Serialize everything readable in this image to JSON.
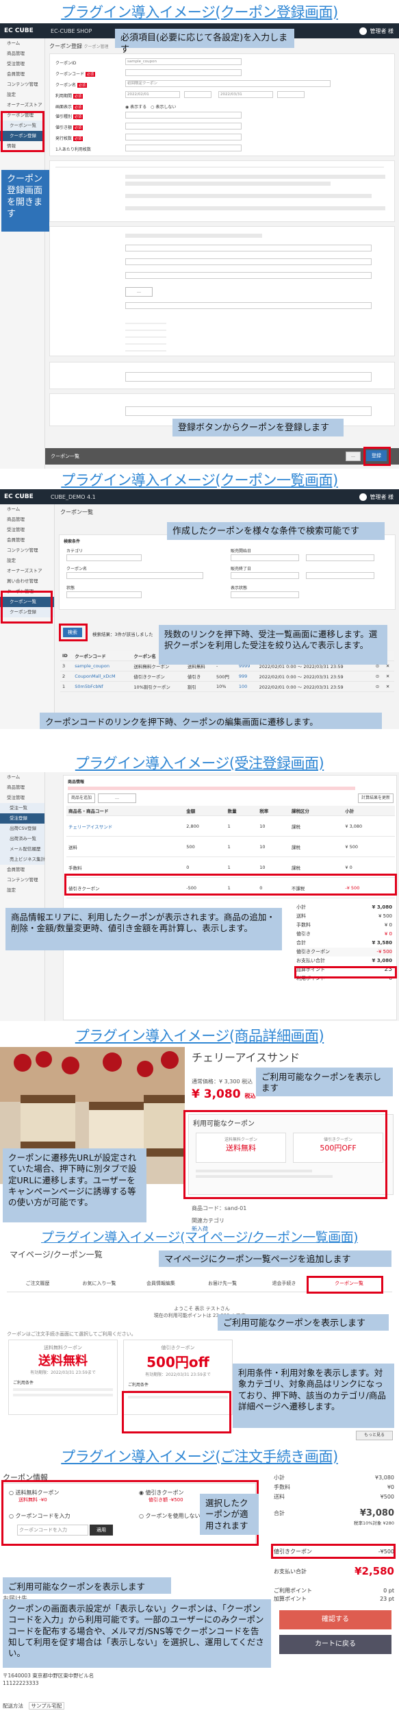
{
  "sections": {
    "s1": "プラグイン導入イメージ(クーポン登録画面)",
    "s2": "プラグイン導入イメージ(クーポン一覧画面)",
    "s3": "プラグイン導入イメージ(受注登録画面)",
    "s4": "プラグイン導入イメージ(商品詳細画面)",
    "s5": "プラグイン導入イメージ(マイページ/クーポン一覧画面)",
    "s6": "プラグイン導入イメージ(ご注文手続き画面)"
  },
  "callouts": {
    "c1": "必須項目(必要に応じて各設定)を入力します",
    "c2": "クーポン登録画面を開きます",
    "c3": "登録ボタンからクーポンを登録します",
    "c4": "作成したクーポンを様々な条件で検索可能です",
    "c5": "残数のリンクを押下時、受注一覧画面に遷移します。選択クーポンを利用した受注を絞り込んで表示します。",
    "c6": "クーポンコードのリンクを押下時、クーポンの編集画面に遷移します。",
    "c7": "商品情報エリアに、利用したクーポンが表示されます。商品の追加・削除・金額/数量変更時、値引き金額を再計算し、表示します。",
    "c8": "ご利用可能なクーポンを表示します",
    "c9": "クーポンに遷移先URLが設定されていた場合、押下時に別タブで設定URLに遷移します。ユーザーをキャンペーンページに誘導する等の使い方が可能です。",
    "c10": "マイページにクーポン一覧ページを追加します",
    "c11": "ご利用可能なクーポンを表示します",
    "c12": "利用条件・利用対象を表示します。対象カテゴリ、対象商品はリンクになっており、押下時、該当のカテゴリ/商品詳細ページへ遷移します。",
    "c13": "選択したクーポンが適用されます",
    "c14": "ご利用可能なクーポンを表示します",
    "c15": "クーポンの画面表示設定が「表示しない」クーポンは、「クーポンコードを入力」から利用可能です。一部のユーザーにのみクーポンコードを配布する場合や、メルマガ/SNS等でクーポンコードを告知して利用を促す場合は「表示しない」を選択し、運用してください。"
  },
  "admin": {
    "logo": "EC CUBE",
    "shop": "EC-CUBE SHOP",
    "shop2": "CUBE_DEMO 4.1",
    "user": "管理者 様",
    "side1": [
      "ホーム",
      "商品管理",
      "受注管理",
      "会員管理",
      "コンテンツ管理",
      "設定",
      "オーナーズストア",
      "クーポン管理",
      "クーポン一覧",
      "クーポン登録",
      "情報"
    ],
    "side2": [
      "ホーム",
      "商品管理",
      "受注管理",
      "会員管理",
      "コンテンツ管理",
      "設定",
      "オーナーズストア",
      "買い合わせ管理",
      "クーポン管理",
      "クーポン一覧",
      "クーポン登録"
    ],
    "side3": [
      "ホーム",
      "商品管理",
      "受注管理",
      "受注一覧",
      "受注登録",
      "出荷CSV登録",
      "出荷済み一覧",
      "メール配信履歴",
      "売上ビジネス集計",
      "会員管理",
      "コンテンツ管理",
      "設定"
    ],
    "save": "登録",
    "back": "クーポン一覧"
  },
  "form": {
    "page_title": "クーポン登録",
    "breadcrumb": "クーポン管理",
    "fields": [
      "クーポン名",
      "クーポンコード",
      "クーポンID",
      "利用期間",
      "画面表示",
      "値引種別",
      "値引き額",
      "発行枚数",
      "利用枚数",
      "1人あたり利用枚数"
    ],
    "code_val": "sample_coupon",
    "name_val": "初回限定クーポン",
    "date_from": "2022/02/01",
    "date_to": "2022/03/31",
    "options": [
      "表示する",
      "表示しない"
    ]
  },
  "list": {
    "page_title": "クーポン一覧",
    "search_title": "検索条件",
    "labels": [
      "カテゴリ",
      "クーポン名",
      "販売開始日",
      "販売終了日",
      "状態",
      "表示状態"
    ],
    "btn": "検索",
    "result": "検索結果：3件が該当しました",
    "headers": [
      "ID",
      "クーポンコード",
      "クーポン名",
      "種別",
      "値引",
      "残数",
      "期間",
      "",
      "",
      ""
    ],
    "rows": [
      [
        "3",
        "sample_coupon",
        "送料無料クーポン",
        "送料無料",
        "-",
        "9999",
        "2022/02/01 0:00 ～ 2022/03/31 23:59"
      ],
      [
        "2",
        "CouponMall_xDcM",
        "値引きクーポン",
        "値引き",
        "500円",
        "999",
        "2022/02/01 0:00 ～ 2022/03/31 23:59"
      ],
      [
        "1",
        "S0m5bFcbNf",
        "10%割引クーポン",
        "割引",
        "10%",
        "100",
        "2022/02/01 0:00 ～ 2022/03/31 23:59"
      ]
    ]
  },
  "order": {
    "title": "商品情報",
    "headers": [
      "商品名・商品コード",
      "金額",
      "数量",
      "税率",
      "課税区分",
      "小計"
    ],
    "rows": [
      [
        "チェリーアイスサンド",
        "2,800",
        "1",
        "10",
        "課税",
        "¥ 3,080"
      ],
      [
        "送料",
        "500",
        "1",
        "10",
        "課税",
        "¥ 500"
      ],
      [
        "手数料",
        "0",
        "1",
        "10",
        "課税",
        "¥ 0"
      ],
      [
        "値引きクーポン",
        "-500",
        "1",
        "0",
        "不課税",
        "-¥ 500"
      ]
    ],
    "summary_labels": [
      "小計",
      "送料",
      "手数料",
      "値引き",
      "合計",
      "値引きクーポン",
      "お支払い合計",
      "加算ポイント",
      "利用ポイント"
    ],
    "summary_vals": [
      "¥ 3,080",
      "¥ 500",
      "¥ 0",
      "¥ 0",
      "¥ 3,580",
      "-¥ 500",
      "¥ 3,080",
      "23",
      "0"
    ],
    "add_btn": "商品を追加",
    "recalc": "計算結果を更新"
  },
  "product": {
    "name": "チェリーアイスサンド",
    "price_label": "通常価格：¥ 3,300 税込",
    "price": "¥ 3,080",
    "tax": "税込",
    "coupon_box": "利用可能なクーポン",
    "coupon1_type": "送料無料クーポン",
    "coupon1_value": "送料無料",
    "coupon2_type": "値引きクーポン",
    "coupon2_value": "500円OFF",
    "code": "商品コード：sand-01",
    "cat_label": "関連カテゴリ",
    "cat": "新入荷"
  },
  "mypage": {
    "title": "マイページ/クーポン一覧",
    "tabs": [
      "ご注文履歴",
      "お気に入り一覧",
      "会員情報編集",
      "お届け先一覧",
      "退会手続き",
      "クーポン一覧"
    ],
    "welcome": "ようこそ 表示 テストさん",
    "points": "現在の利用可能ポイントは 23,000pt です。",
    "hint": "クーポンはご注文手続き画面にて選択してご利用ください。",
    "c1_type": "送料無料クーポン",
    "c1_value": "送料無料",
    "c1_date": "有効期限：2022/03/31 23:59まで",
    "c2_type": "値引きクーポン",
    "c2_value": "500円off",
    "c2_date": "有効期限：2022/03/31 23:59まで",
    "cond_title": "ご利用条件",
    "more": "もっと見る"
  },
  "checkout": {
    "title": "クーポン情報",
    "opt1": "送料無料クーポン",
    "opt1_sub": "送料無料 -¥0",
    "opt2": "値引きクーポン",
    "opt2_sub": "値引き額 -¥500",
    "opt3": "クーポンコードを入力",
    "opt4": "クーポンを使用しない",
    "input_ph": "クーポンコードを入力",
    "apply": "適用",
    "sum_labels": [
      "小計",
      "手数料",
      "送料",
      "合計",
      "値引きクーポン",
      "お支払い合計",
      "ご利用ポイント",
      "加算ポイント"
    ],
    "sum_vals": [
      "¥3,080",
      "¥0",
      "¥500",
      "¥3,080",
      "-¥500",
      "¥2,580",
      "0 pt",
      "23 pt"
    ],
    "tax_note": "税率10%対象 ¥280",
    "confirm": "確認する",
    "back_cart": "カートに戻る",
    "delivery_label": "お届け先",
    "address": "〒1640003 東京都中野区東中野ビル名",
    "phone": "11122223333",
    "method_label": "配送方法",
    "method": "サンプル宅配"
  },
  "colors": {
    "accent": "#2e86d4",
    "red": "#e0001a",
    "callout": "#b3cbe4",
    "callout_dark": "#2e72b8",
    "admin_bar": "#1f2a36"
  }
}
